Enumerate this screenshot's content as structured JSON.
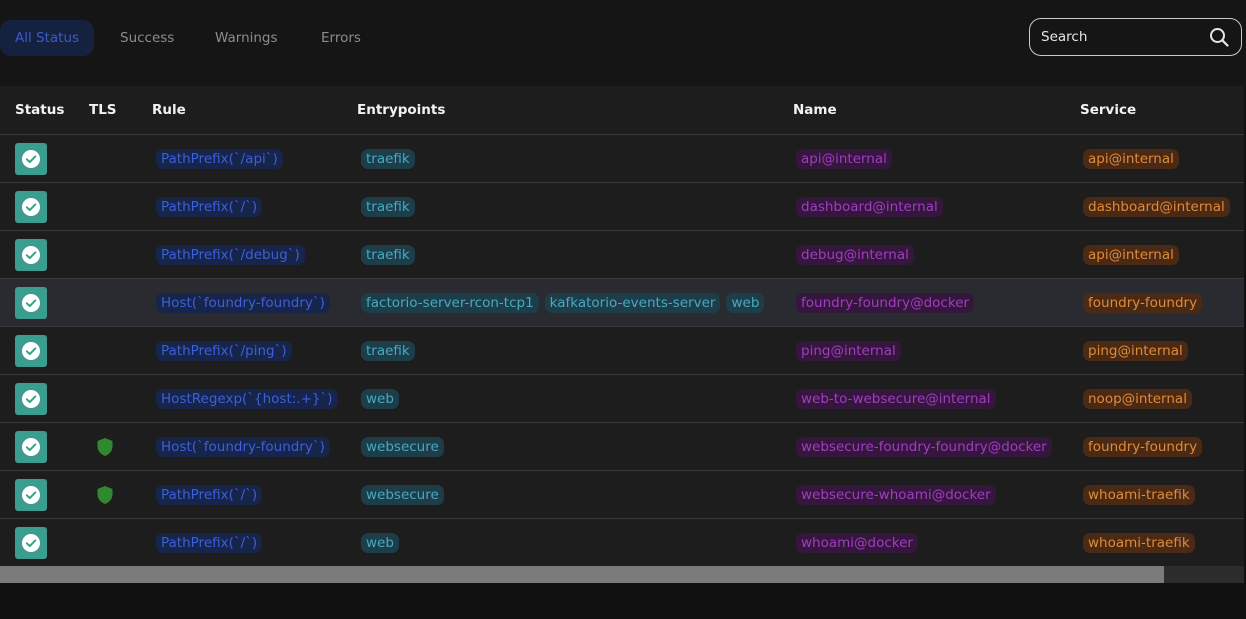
{
  "filters": {
    "tabs": [
      {
        "label": "All Status",
        "active": true
      },
      {
        "label": "Success",
        "active": false
      },
      {
        "label": "Warnings",
        "active": false
      },
      {
        "label": "Errors",
        "active": false
      }
    ],
    "search_placeholder": "Search",
    "search_icon": "magnifier"
  },
  "table": {
    "columns": [
      "Status",
      "TLS",
      "Rule",
      "Entrypoints",
      "Name",
      "Service"
    ],
    "rows": [
      {
        "status": "success",
        "tls": false,
        "rule": "PathPrefix(`/api`)",
        "entrypoints": [
          "traefik"
        ],
        "name": "api@internal",
        "service": "api@internal"
      },
      {
        "status": "success",
        "tls": false,
        "rule": "PathPrefix(`/`)",
        "entrypoints": [
          "traefik"
        ],
        "name": "dashboard@internal",
        "service": "dashboard@internal"
      },
      {
        "status": "success",
        "tls": false,
        "rule": "PathPrefix(`/debug`)",
        "entrypoints": [
          "traefik"
        ],
        "name": "debug@internal",
        "service": "api@internal"
      },
      {
        "status": "success",
        "tls": false,
        "rule": "Host(`foundry-foundry`)",
        "entrypoints": [
          "factorio-server-rcon-tcp1",
          "kafkatorio-events-server",
          "web"
        ],
        "name": "foundry-foundry@docker",
        "service": "foundry-foundry",
        "highlighted": true
      },
      {
        "status": "success",
        "tls": false,
        "rule": "PathPrefix(`/ping`)",
        "entrypoints": [
          "traefik"
        ],
        "name": "ping@internal",
        "service": "ping@internal"
      },
      {
        "status": "success",
        "tls": false,
        "rule": "HostRegexp(`{host:.+}`)",
        "entrypoints": [
          "web"
        ],
        "name": "web-to-websecure@internal",
        "service": "noop@internal"
      },
      {
        "status": "success",
        "tls": true,
        "rule": "Host(`foundry-foundry`)",
        "entrypoints": [
          "websecure"
        ],
        "name": "websecure-foundry-foundry@docker",
        "service": "foundry-foundry"
      },
      {
        "status": "success",
        "tls": true,
        "rule": "PathPrefix(`/`)",
        "entrypoints": [
          "websecure"
        ],
        "name": "websecure-whoami@docker",
        "service": "whoami-traefik"
      },
      {
        "status": "success",
        "tls": false,
        "rule": "PathPrefix(`/`)",
        "entrypoints": [
          "web"
        ],
        "name": "whoami@docker",
        "service": "whoami-traefik"
      }
    ]
  },
  "colors": {
    "status_success": "#3a9d8f",
    "tls_shield": "#2f8a2f",
    "rule_chip": "#3d5fd8",
    "entrypoint_chip": "#4aa8c0",
    "name_chip": "#a03cc0",
    "service_chip": "#e08a3a",
    "active_tab": "#3d59c9"
  }
}
